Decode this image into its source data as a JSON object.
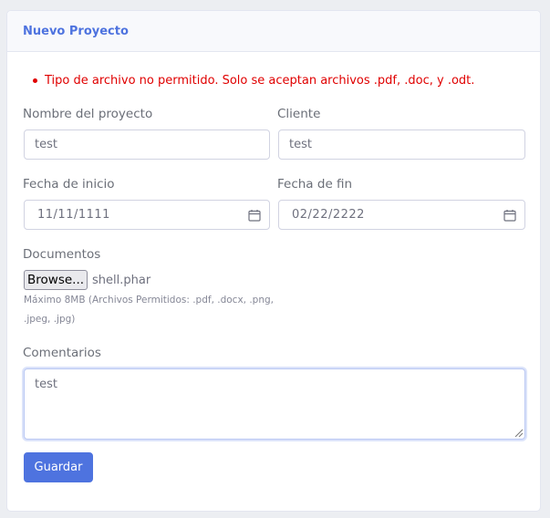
{
  "card": {
    "title": "Nuevo Proyecto"
  },
  "errors": [
    "Tipo de archivo no permitido. Solo se aceptan archivos .pdf, .doc, y .odt."
  ],
  "form": {
    "project_name": {
      "label": "Nombre del proyecto",
      "value": "test"
    },
    "client": {
      "label": "Cliente",
      "value": "test"
    },
    "start_date": {
      "label": "Fecha de inicio",
      "value": "11/11/1111",
      "icon": "calendar-icon"
    },
    "end_date": {
      "label": "Fecha de fin",
      "value": "02/22/2222",
      "icon": "calendar-icon"
    },
    "documents": {
      "label": "Documentos",
      "browse_label": "Browse...",
      "file_name": "shell.phar",
      "help": "Máximo 8MB (Archivos Permitidos: .pdf, .docx, .png, .jpeg, .jpg)"
    },
    "comments": {
      "label": "Comentarios",
      "value": "test"
    },
    "save_label": "Guardar"
  },
  "colors": {
    "accent": "#4e73df",
    "error": "#e00000"
  }
}
